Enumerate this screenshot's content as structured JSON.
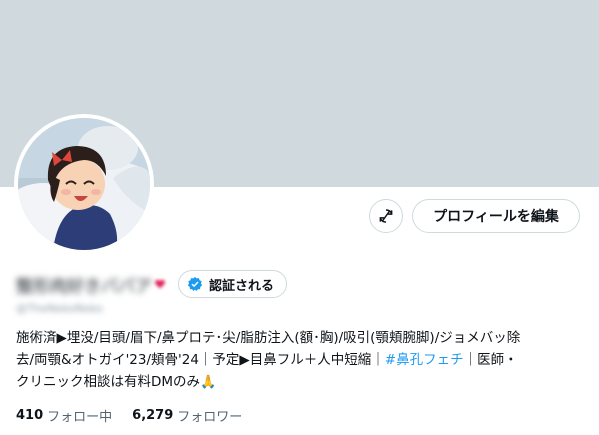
{
  "profile": {
    "display_name": "整形肉好きババア",
    "verify_label": "認証される",
    "handle": "@TheNekoNeko",
    "edit_label": "プロフィールを編集",
    "bio": {
      "line1": "施術済▶埋没/目頭/眉下/鼻プロテ･尖/脂肪注入(額･胸)/吸引(顎頬腕脚)/ジョメバッ除",
      "line2_pre": "去/両顎&オトガイ'23/頬骨'24｜予定▶目鼻フル＋人中短縮｜",
      "line2_tag": "#鼻孔フェチ",
      "line2_post": "｜医師・",
      "line3": "クリニック相談は有料DMのみ",
      "line3_emoji": "🙏"
    },
    "following_count": "410",
    "following_label": "フォロー中",
    "followers_count": "6,279",
    "followers_label": "フォロワー"
  },
  "colors": {
    "banner": "#cfd9de",
    "accent": "#1d9bf0",
    "text": "#0f1419",
    "muted": "#536471"
  },
  "icons": {
    "action": "sync-off-icon",
    "verify": "verified-badge-icon",
    "heart": "heart-icon"
  }
}
